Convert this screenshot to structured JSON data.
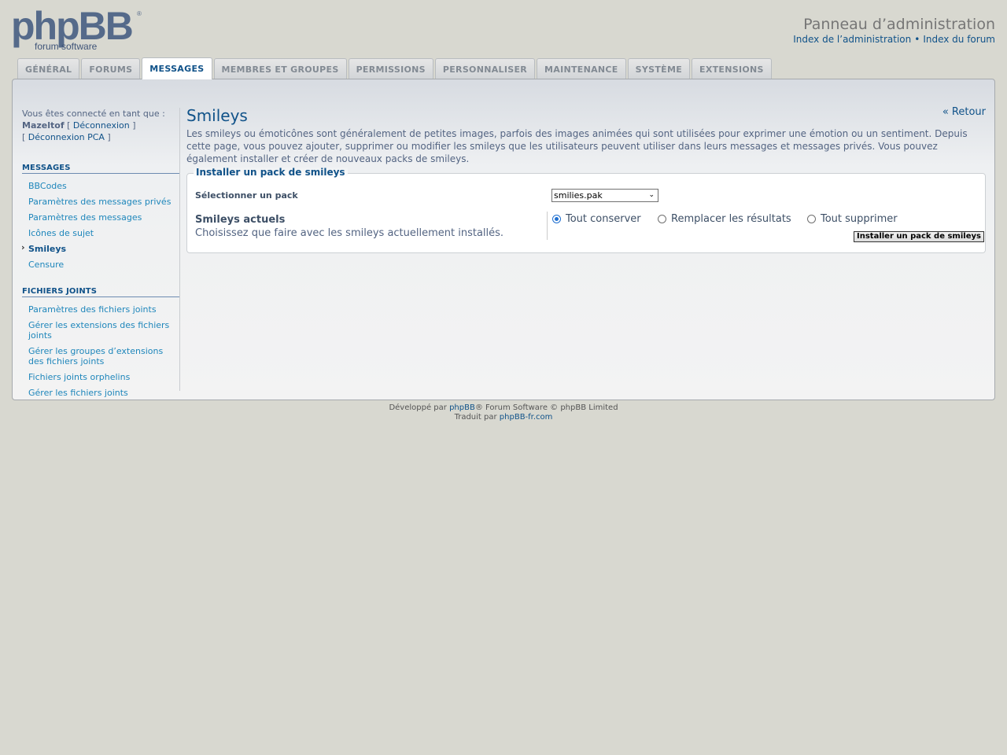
{
  "header": {
    "logo_text": "phpBB forum software",
    "panel_title": "Panneau d’administration",
    "links": [
      "Index de l’administration",
      "Index du forum"
    ],
    "separator": "•"
  },
  "tabs": [
    {
      "label": "GÉNÉRAL",
      "active": false
    },
    {
      "label": "FORUMS",
      "active": false
    },
    {
      "label": "MESSAGES",
      "active": true
    },
    {
      "label": "MEMBRES ET GROUPES",
      "active": false
    },
    {
      "label": "PERMISSIONS",
      "active": false
    },
    {
      "label": "PERSONNALISER",
      "active": false
    },
    {
      "label": "MAINTENANCE",
      "active": false
    },
    {
      "label": "SYSTÈME",
      "active": false
    },
    {
      "label": "EXTENSIONS",
      "active": false
    }
  ],
  "sidebar": {
    "login_prefix": "Vous êtes connecté en tant que :",
    "username": "Mazeltof",
    "logout": "Déconnexion",
    "logout_acp": "Déconnexion PCA",
    "sections": [
      {
        "heading": "MESSAGES",
        "items": [
          {
            "label": "BBCodes",
            "active": false
          },
          {
            "label": "Paramètres des messages privés",
            "active": false
          },
          {
            "label": "Paramètres des messages",
            "active": false
          },
          {
            "label": "Icônes de sujet",
            "active": false
          },
          {
            "label": "Smileys",
            "active": true
          },
          {
            "label": "Censure",
            "active": false
          }
        ]
      },
      {
        "heading": "FICHIERS JOINTS",
        "items": [
          {
            "label": "Paramètres des fichiers joints",
            "active": false
          },
          {
            "label": "Gérer les extensions des fichiers joints",
            "active": false
          },
          {
            "label": "Gérer les groupes d’extensions des fichiers joints",
            "active": false
          },
          {
            "label": "Fichiers joints orphelins",
            "active": false
          },
          {
            "label": "Gérer les fichiers joints",
            "active": false
          }
        ]
      }
    ]
  },
  "content": {
    "title": "Smileys",
    "back_link": "« Retour",
    "intro": "Les smileys ou émoticônes sont généralement de petites images, parfois des images animées qui sont utilisées pour exprimer une émotion ou un sentiment. Depuis cette page, vous pouvez ajouter, supprimer ou modifier les smileys que les utilisateurs peuvent utiliser dans leurs messages et messages privés. Vous pouvez également installer et créer de nouveaux packs de smileys.",
    "fieldset_legend": "Installer un pack de smileys",
    "select_label": "Sélectionner un pack",
    "select_value": "smilies.pak",
    "current_label": "Smileys actuels",
    "current_desc": "Choisissez que faire avec les smileys actuellement installés.",
    "radios": [
      {
        "label": "Tout conserver",
        "checked": true
      },
      {
        "label": "Remplacer les résultats",
        "checked": false
      },
      {
        "label": "Tout supprimer",
        "checked": false
      }
    ],
    "install_button": "Installer un pack de smileys"
  },
  "footer": {
    "line1_prefix": "Développé par",
    "line1_link": "phpBB",
    "line1_suffix": "® Forum Software © phpBB Limited",
    "line2_prefix": "Traduit par",
    "line2_link": "phpBB-fr.com"
  },
  "colors": {
    "accent": "#105289",
    "link": "#1e86bb",
    "page_bg": "#d8d8d0"
  }
}
